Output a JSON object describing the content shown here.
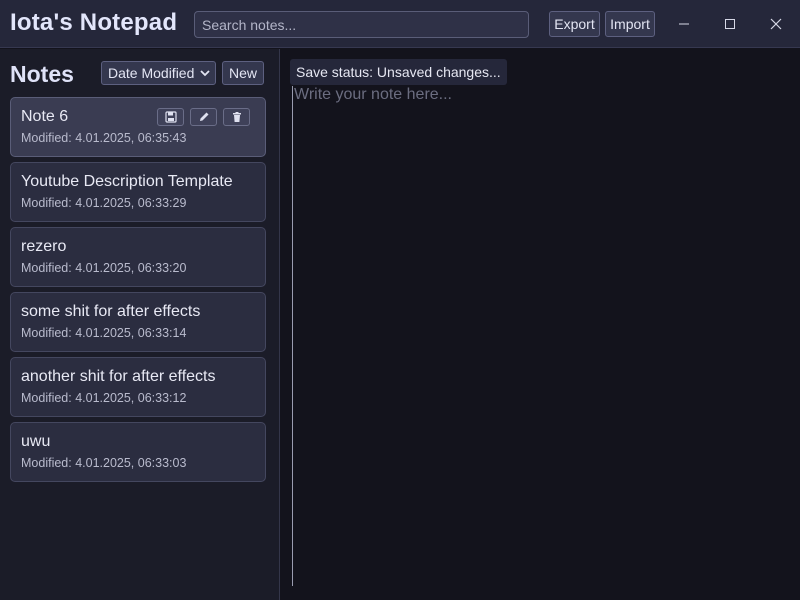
{
  "app": {
    "title": "Iota's Notepad"
  },
  "search": {
    "placeholder": "Search notes...",
    "value": ""
  },
  "toolbar": {
    "export_label": "Export",
    "import_label": "Import"
  },
  "window_controls": {
    "minimize_icon": "minimize-icon",
    "maximize_icon": "maximize-icon",
    "close_icon": "close-icon"
  },
  "sidebar": {
    "heading": "Notes",
    "sort_selected": "Date Modified",
    "new_label": "New",
    "notes": [
      {
        "title": "Note 6",
        "modified": "Modified: 4.01.2025, 06:35:43",
        "active": true
      },
      {
        "title": "Youtube Description Template",
        "modified": "Modified: 4.01.2025, 06:33:29"
      },
      {
        "title": "rezero",
        "modified": "Modified: 4.01.2025, 06:33:20"
      },
      {
        "title": "some shit for after effects",
        "modified": "Modified: 4.01.2025, 06:33:14"
      },
      {
        "title": "another shit for after effects",
        "modified": "Modified: 4.01.2025, 06:33:12"
      },
      {
        "title": "uwu",
        "modified": "Modified: 4.01.2025, 06:33:03"
      }
    ],
    "card_actions": [
      "save-icon",
      "edit-icon",
      "delete-icon"
    ]
  },
  "editor": {
    "save_status": "Save status: Unsaved changes...",
    "placeholder": "Write your note here...",
    "value": ""
  },
  "colors": {
    "background": "#13131c",
    "titlebar": "#25273a",
    "sidebar": "#1b1c28",
    "card": "#2b2d40",
    "card_active": "#3a3c52",
    "accent_text": "#e3e6fb"
  }
}
